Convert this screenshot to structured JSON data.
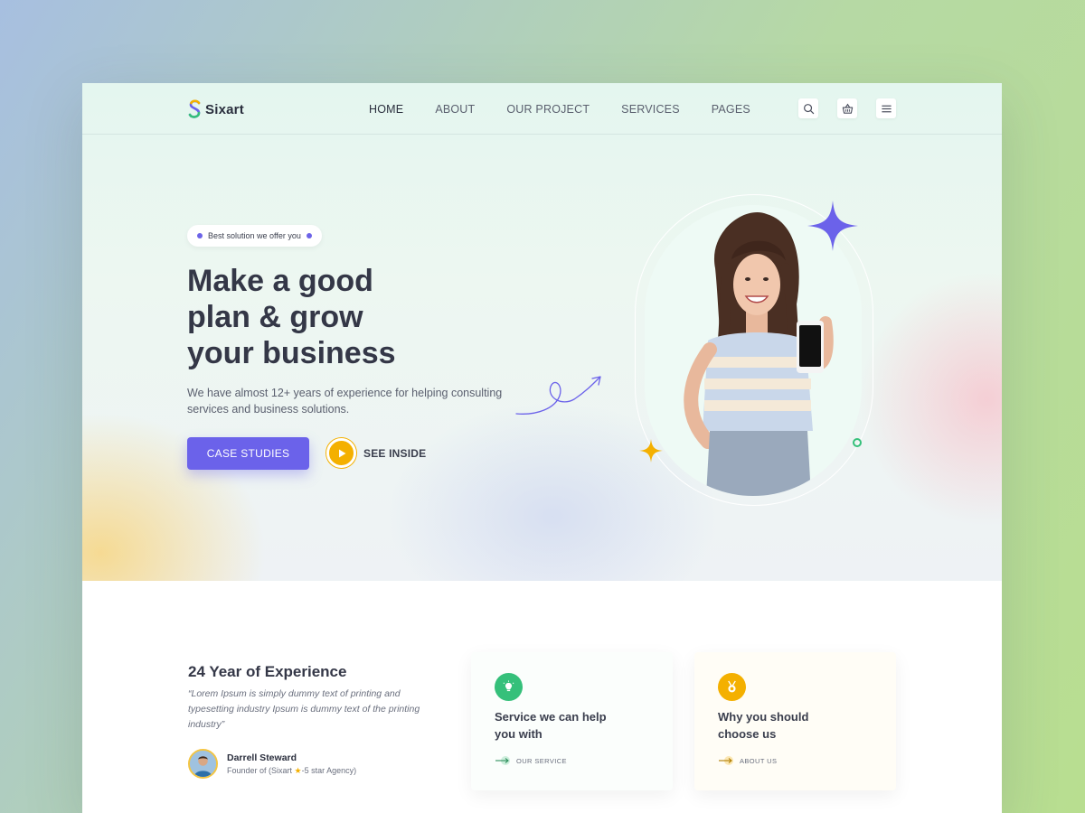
{
  "brand": {
    "name": "Sixart"
  },
  "nav": {
    "items": [
      {
        "label": "HOME",
        "active": true
      },
      {
        "label": "ABOUT",
        "active": false
      },
      {
        "label": "OUR PROJECT",
        "active": false
      },
      {
        "label": "SERVICES",
        "active": false
      },
      {
        "label": "PAGES",
        "active": false
      }
    ],
    "icons": [
      "search-icon",
      "basket-icon",
      "menu-icon"
    ]
  },
  "hero": {
    "badge": "Best solution we offer you",
    "headline_lines": [
      "Make a good",
      "plan & grow",
      "your business"
    ],
    "subtext": "We have almost 12+ years of experience for helping consulting services and business solutions.",
    "primary_button": "CASE STUDIES",
    "secondary_button": "SEE INSIDE"
  },
  "experience": {
    "title": "24 Year of Experience",
    "quote": "“Lorem Ipsum is simply dummy text of printing and typesetting industry Ipsum is dummy text of the printing industry”",
    "author_name": "Darrell Steward",
    "author_role_prefix": "Founder of (Sixart ",
    "author_role_star": "★",
    "author_role_suffix": "-5 star Agency)"
  },
  "cards": [
    {
      "title": "Service we can help you with",
      "link": "OUR SERVICE",
      "icon": "lightbulb-icon",
      "accent": "#35c07a"
    },
    {
      "title": "Why you should choose us",
      "link": "ABOUT US",
      "icon": "medal-icon",
      "accent": "#f4b000"
    }
  ],
  "colors": {
    "primary": "#6b62ea",
    "accent_yellow": "#f4b000",
    "accent_green": "#35c07a",
    "text_dark": "#343747"
  }
}
